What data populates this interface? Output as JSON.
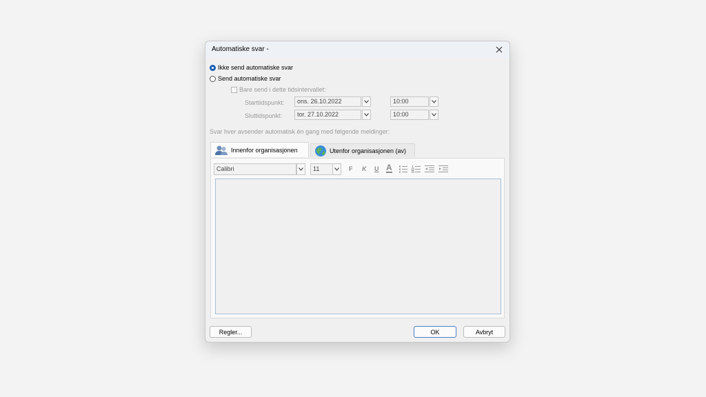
{
  "dialog": {
    "title": "Automatiske svar -",
    "options": {
      "no_auto_reply": "Ikke send automatiske svar",
      "send_auto_reply": "Send automatiske svar",
      "only_in_interval": "Bare send i dette tidsintervallet:"
    },
    "start": {
      "label": "Starttidspunkt:",
      "date": "ons. 26.10.2022",
      "time": "10:00"
    },
    "end": {
      "label": "Sluttidspunkt:",
      "date": "tor. 27.10.2022",
      "time": "10:00"
    },
    "description": "Svar hver avsender automatisk én gang med følgende meldinger:",
    "tabs": {
      "inside": "Innenfor organisasjonen",
      "outside": "Utenfor organisasjonen (av)"
    },
    "toolbar": {
      "font": "Calibri",
      "size": "11",
      "bold": "F",
      "italic": "K",
      "underline": "U",
      "font_color": "A"
    },
    "buttons": {
      "rules": "Regler...",
      "ok": "OK",
      "cancel": "Avbryt"
    },
    "colors": {
      "accent": "#1a5fb4",
      "disabled_text": "#9a9a9a"
    }
  }
}
